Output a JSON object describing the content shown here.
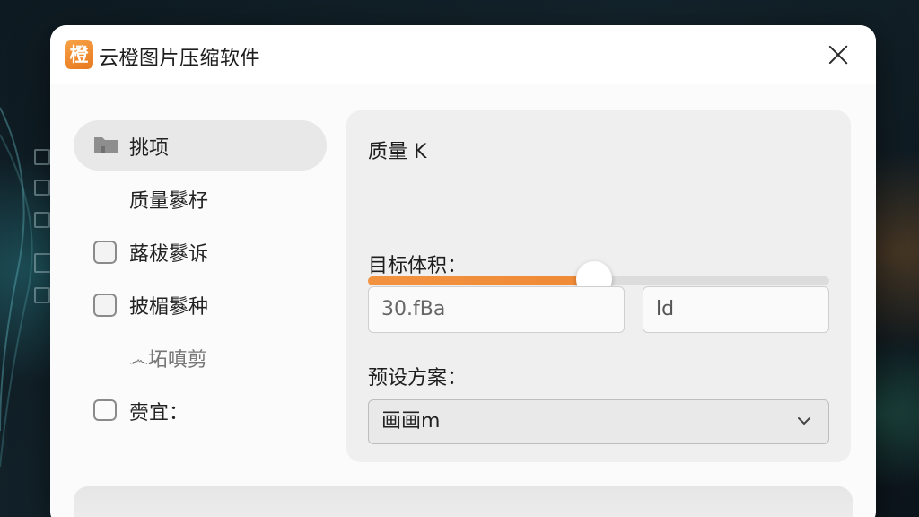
{
  "window": {
    "title": "云橙图片压缩软件",
    "icon_glyph": "橙",
    "icon_color": "#f08a36"
  },
  "sidebar": {
    "items": [
      {
        "label": "挑项",
        "icon": "folder-icon",
        "active": true
      },
      {
        "label": "质量鬖杍",
        "icon": null
      },
      {
        "label": "蕗秡鬖诉",
        "icon": "checkbox-icon"
      },
      {
        "label": "披楣鬖种",
        "icon": "checkbox-icon"
      },
      {
        "label": "෴坧嗔剪",
        "icon": null
      },
      {
        "label": "赍宜：",
        "icon": "bubble-icon"
      }
    ]
  },
  "panel": {
    "quality_label": "质量 K",
    "quality_value": 0.49,
    "target_size_label": "目标体积：",
    "size_input_value": "30.fBa",
    "unit_input_value": "ld",
    "preset_label": "预设方案：",
    "preset_selected": "画画m"
  },
  "colors": {
    "accent": "#f08a36",
    "panel_bg": "#efefef",
    "window_bg": "#fbfbfb"
  }
}
